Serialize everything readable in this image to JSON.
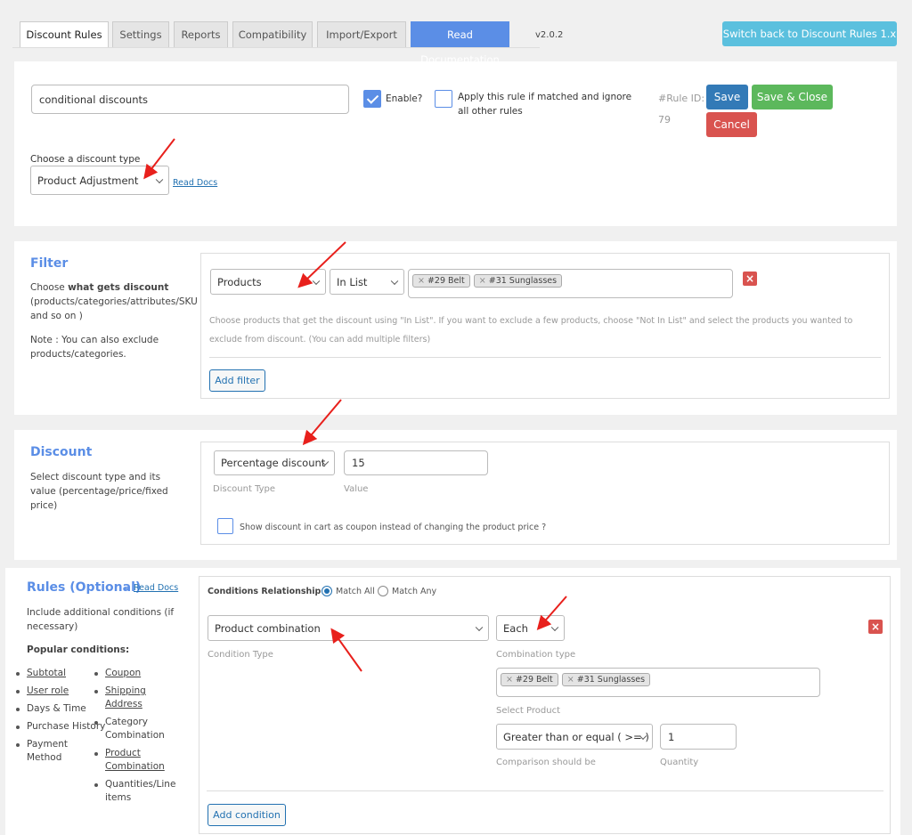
{
  "tabs": [
    {
      "label": "Discount Rules",
      "active": true
    },
    {
      "label": "Settings"
    },
    {
      "label": "Reports"
    },
    {
      "label": "Compatibility"
    },
    {
      "label": "Import/Export"
    },
    {
      "label": "Read Documentation"
    }
  ],
  "version": "v2.0.2",
  "switch_button": "Switch back to Discount Rules 1.x",
  "rule": {
    "name_value": "conditional discounts",
    "enable_label": "Enable?",
    "enable_checked": true,
    "exclusive_label": "Apply this rule if matched and ignore all other rules",
    "exclusive_checked": false,
    "rule_id_label": "#Rule ID:",
    "rule_id": "79",
    "save": "Save",
    "save_close": "Save & Close",
    "cancel": "Cancel",
    "discount_type_label": "Choose a discount type",
    "discount_type_value": "Product Adjustment",
    "read_docs": "Read Docs"
  },
  "filter": {
    "title": "Filter",
    "desc_prefix": "Choose ",
    "desc_bold": "what gets discount",
    "desc_rest": "(products/categories/attributes/SKU and so on )",
    "note": "Note : You can also exclude products/categories.",
    "type_value": "Products",
    "method_value": "In List",
    "chips": [
      "#29 Belt",
      "#31 Sunglasses"
    ],
    "hint": "Choose products that get the discount using \"In List\". If you want to exclude a few products, choose \"Not In List\" and select the products you wanted to exclude from discount. (You can add multiple filters)",
    "add_button": "Add filter"
  },
  "discount": {
    "title": "Discount",
    "desc": "Select discount type and its value (percentage/price/fixed price)",
    "type_value": "Percentage discount",
    "type_label": "Discount Type",
    "value": "15",
    "value_label": "Value",
    "coupon_label": "Show discount in cart as coupon instead of changing the product price ?",
    "coupon_checked": false
  },
  "rules": {
    "title": "Rules (Optional)",
    "dash": "-",
    "read_docs": "Read Docs",
    "desc": "Include additional conditions (if necessary)",
    "popular_label": "Popular conditions:",
    "popular_col1": [
      {
        "label": "Subtotal",
        "link": true
      },
      {
        "label": "User role",
        "link": true
      },
      {
        "label": "Days & Time",
        "link": false
      },
      {
        "label": "Purchase History",
        "link": false
      },
      {
        "label": "Payment Method",
        "link": false
      }
    ],
    "popular_col2": [
      {
        "label": "Coupon",
        "link": true
      },
      {
        "label": "Shipping Address",
        "link": true
      },
      {
        "label": "Category Combination",
        "link": false
      },
      {
        "label": "Product Combination",
        "link": true
      },
      {
        "label": "Quantities/Line items",
        "link": false
      }
    ],
    "relationship_label": "Conditions Relationship",
    "match_all": "Match All",
    "match_any": "Match Any",
    "selected_relationship": "Match All",
    "condition_type_value": "Product combination",
    "condition_type_label": "Condition Type",
    "combination_value": "Each",
    "combination_label": "Combination type",
    "product_chips": [
      "#29 Belt",
      "#31 Sunglasses"
    ],
    "select_product_label": "Select Product",
    "comparison_value": "Greater than or equal ( >= )",
    "comparison_label": "Comparison should be",
    "quantity_value": "1",
    "quantity_label": "Quantity",
    "add_button": "Add condition"
  },
  "colors": {
    "accent": "#5b8ee6",
    "save": "#337ab7",
    "save_close": "#5cb85c",
    "cancel": "#d9534f",
    "switch": "#5bc0de",
    "annotation_arrow": "#e8201c"
  }
}
